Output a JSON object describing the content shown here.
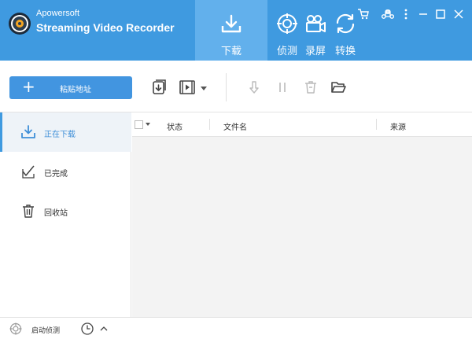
{
  "header": {
    "brand_small": "Apowersoft",
    "brand_big": "Streaming Video Recorder",
    "nav": [
      {
        "label": "下载",
        "icon": "download-tray-icon",
        "active": true
      },
      {
        "label": "侦测",
        "icon": "target-icon",
        "active": false
      },
      {
        "label": "录屏",
        "icon": "video-camera-icon",
        "active": false
      },
      {
        "label": "转换",
        "icon": "convert-icon",
        "active": false
      }
    ],
    "window_controls": [
      "cart-icon",
      "command-icon",
      "more-icon",
      "minimize-icon",
      "maximize-icon",
      "close-icon"
    ]
  },
  "toolbar": {
    "paste_label": "粘贴地址",
    "icons": [
      "import-download-icon",
      "video-format-icon",
      "dropdown-caret-icon",
      "start-download-icon",
      "pause-icon",
      "delete-icon",
      "open-folder-icon"
    ]
  },
  "sidebar": {
    "items": [
      {
        "label": "正在下载",
        "icon": "downloading-icon"
      },
      {
        "label": "已完成",
        "icon": "completed-check-icon"
      },
      {
        "label": "回收站",
        "icon": "recycle-bin-icon"
      }
    ]
  },
  "table": {
    "columns": [
      "状态",
      "文件名",
      "来源"
    ],
    "rows": []
  },
  "footer": {
    "detect_label": "启动侦测",
    "icons": [
      "detect-icon",
      "clock-icon",
      "chevron-up-icon"
    ]
  },
  "colors": {
    "accent": "#3f9ae0",
    "active_tab": "#62b0ec",
    "button": "#4295e0"
  }
}
